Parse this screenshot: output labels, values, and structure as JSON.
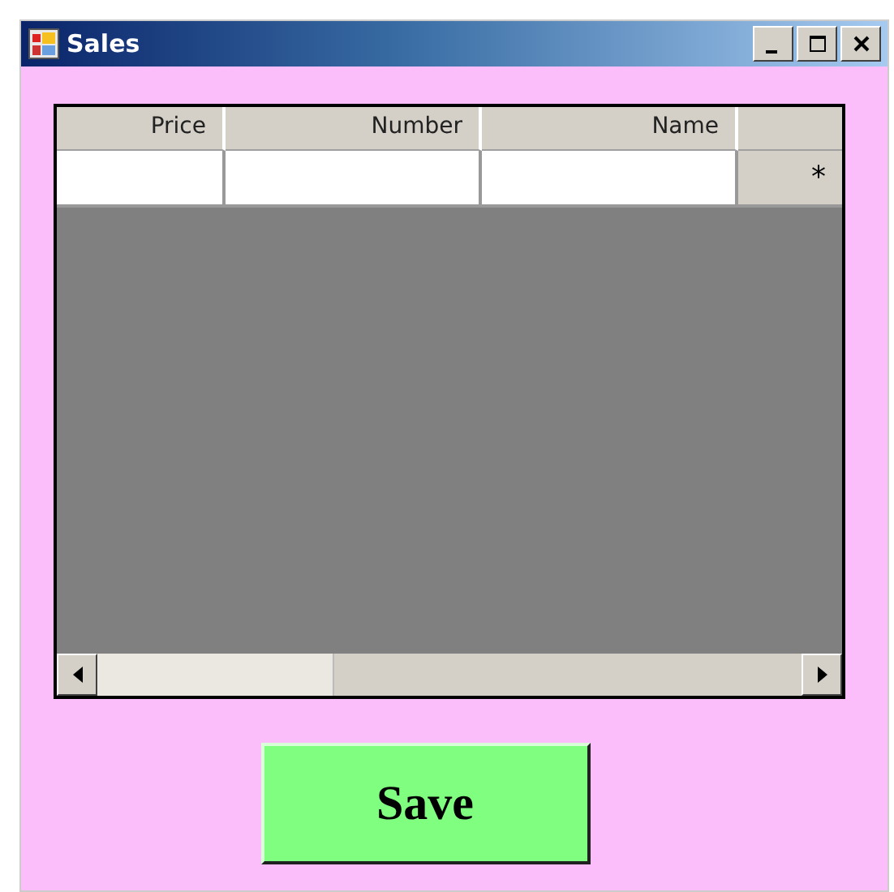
{
  "window": {
    "title": "Sales"
  },
  "grid": {
    "columns": [
      "Price",
      "Number",
      "Name"
    ],
    "new_row": {
      "marker": "*"
    }
  },
  "save_button": {
    "label": "Save"
  }
}
